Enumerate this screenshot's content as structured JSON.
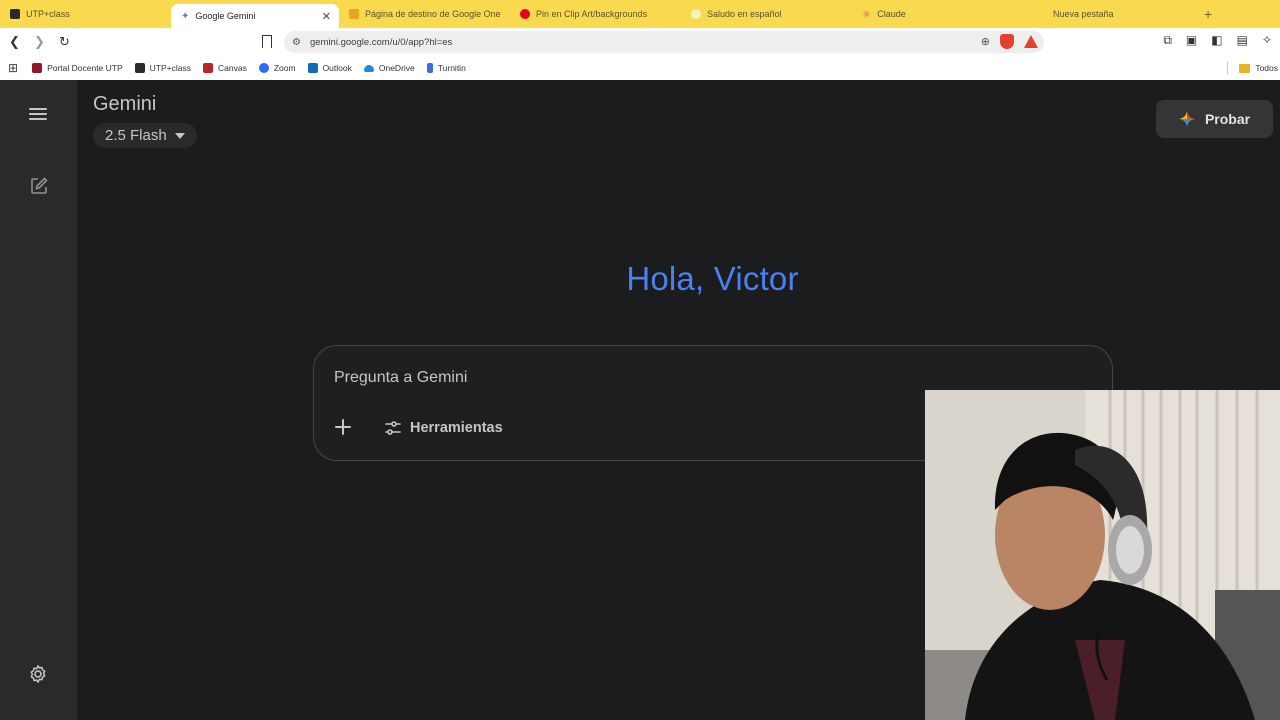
{
  "browser": {
    "tabs": [
      {
        "label": "UTP+class",
        "active": false,
        "color": "#2a2a2a"
      },
      {
        "label": "Google Gemini",
        "active": true,
        "color": "#4a80f0"
      },
      {
        "label": "Página de destino de Google One",
        "active": false,
        "color": "#e8a620"
      },
      {
        "label": "Pin en Clip Art/backgrounds",
        "active": false,
        "color": "#e60023"
      },
      {
        "label": "Saludo en español",
        "active": false,
        "color": "#f7f0c0"
      },
      {
        "label": "Claude",
        "active": false,
        "color": "#d97757"
      },
      {
        "label": "Nueva pestaña",
        "active": false,
        "color": "#f9d94e"
      }
    ],
    "url": "gemini.google.com/u/0/app?hl=es",
    "bookmarks": [
      {
        "label": "Portal Docente UTP",
        "icon": "utp-icon",
        "color": "#8b1a2b"
      },
      {
        "label": "UTP+class",
        "icon": "utp-icon",
        "color": "#2a2a2a"
      },
      {
        "label": "Canvas",
        "icon": "canvas-icon",
        "color": "#b8252d"
      },
      {
        "label": "Zoom",
        "icon": "zoom-icon",
        "color": "#2d6cf0"
      },
      {
        "label": "Outlook",
        "icon": "outlook-icon",
        "color": "#0f6cbd"
      },
      {
        "label": "OneDrive",
        "icon": "onedrive-icon",
        "color": "#1e88e5"
      },
      {
        "label": "Turnitin",
        "icon": "turnitin-icon",
        "color": "#3a6fd8"
      }
    ],
    "bookmarks_right": "Todos"
  },
  "gemini": {
    "title": "Gemini",
    "model": "2.5 Flash",
    "try_button": "Probar",
    "greeting": "Hola, Victor",
    "prompt_placeholder": "Pregunta a Gemini",
    "tools_label": "Herramientas"
  },
  "colors": {
    "accent": "#4a80f0",
    "background": "#1b1c1d",
    "rail": "#282a2c",
    "tab_strip": "#f9d94e"
  }
}
